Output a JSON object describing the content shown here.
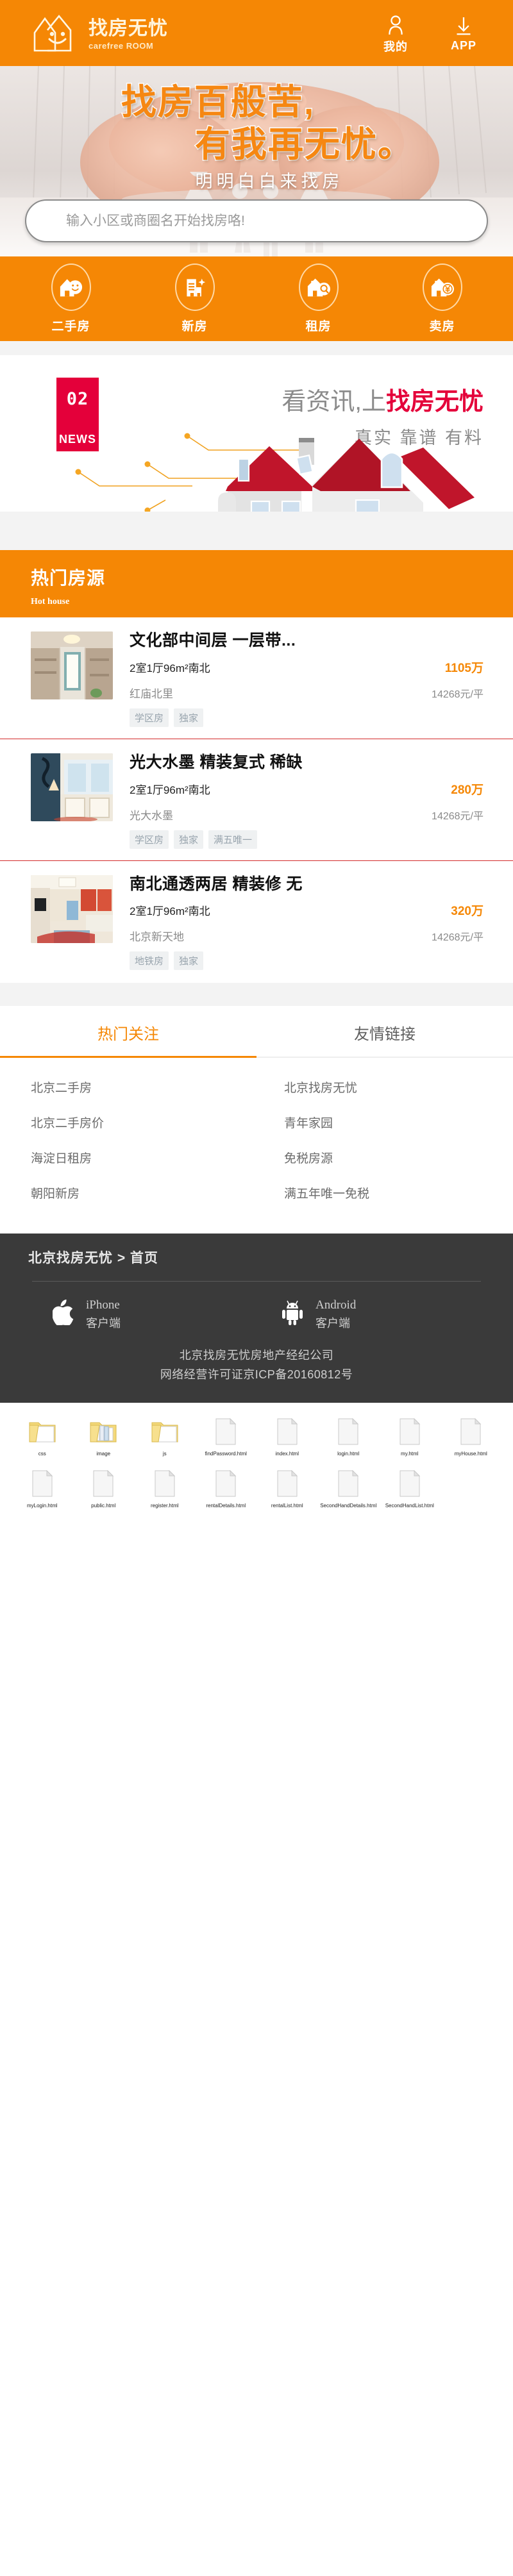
{
  "header": {
    "brand_name": "找房无忧",
    "brand_sub": "carefree ROOM",
    "actions": [
      {
        "label": "我的",
        "icon": "user-icon"
      },
      {
        "label": "APP",
        "icon": "download-icon"
      }
    ]
  },
  "hero": {
    "line1": "找房百般苦,",
    "line2": "有我再无忧。",
    "line3": "明明白白来找房"
  },
  "search": {
    "value": "",
    "placeholder": "输入小区或商圈名开始找房咯!"
  },
  "categories": [
    {
      "label": "二手房",
      "icon": "house-smile-icon"
    },
    {
      "label": "新房",
      "icon": "new-building-icon"
    },
    {
      "label": "租房",
      "icon": "house-search-icon"
    },
    {
      "label": "卖房",
      "icon": "house-yuan-icon"
    }
  ],
  "news": {
    "badge_number": "02",
    "badge_word": "NEWS",
    "title_gray": "看资讯,上",
    "title_red": "找房无忧",
    "subtitle": "真实 靠谱 有料"
  },
  "hot_house": {
    "title_cn": "热门房源",
    "title_en": "Hot house",
    "listings": [
      {
        "title": "文化部中间层 一层带...",
        "spec": "2室1厅96m²南北",
        "price": "1105万",
        "area": "红庙北里",
        "unit_price": "14268元/平",
        "tags": [
          "学区房",
          "独家"
        ]
      },
      {
        "title": "光大水墨 精装复式 稀缺",
        "spec": "2室1厅96m²南北",
        "price": "280万",
        "area": "光大水墨",
        "unit_price": "14268元/平",
        "tags": [
          "学区房",
          "独家",
          "满五唯一"
        ]
      },
      {
        "title": "南北通透两居 精装修 无",
        "spec": "2室1厅96m²南北",
        "price": "320万",
        "area": "北京新天地",
        "unit_price": "14268元/平",
        "tags": [
          "地铁房",
          "独家"
        ]
      }
    ]
  },
  "footer_links": {
    "tabs": [
      {
        "label": "热门关注",
        "active": true
      },
      {
        "label": "友情链接",
        "active": false
      }
    ],
    "left_links": [
      "北京二手房",
      "北京二手房价",
      "海淀日租房",
      "朝阳新房"
    ],
    "right_links": [
      "北京找房无忧",
      "青年家园",
      "免税房源",
      "满五年唯一免税"
    ]
  },
  "dark_footer": {
    "breadcrumb": "北京找房无忧 > 首页",
    "apps": [
      {
        "icon": "apple-icon",
        "en": "iPhone",
        "cn": "客户端"
      },
      {
        "icon": "android-icon",
        "en": "Android",
        "cn": "客户端"
      }
    ],
    "legal_line1": "北京找房无忧房地产经纪公司",
    "legal_line2": "网络经营许可证京ICP备20160812号"
  },
  "files": [
    {
      "name": "css",
      "type": "folder"
    },
    {
      "name": "image",
      "type": "folder-full"
    },
    {
      "name": "js",
      "type": "folder"
    },
    {
      "name": "findPassword.html",
      "type": "file"
    },
    {
      "name": "index.html",
      "type": "file"
    },
    {
      "name": "login.html",
      "type": "file"
    },
    {
      "name": "my.html",
      "type": "file"
    },
    {
      "name": "myHouse.html",
      "type": "file"
    },
    {
      "name": "myLogin.html",
      "type": "file"
    },
    {
      "name": "public.html",
      "type": "file"
    },
    {
      "name": "register.html",
      "type": "file"
    },
    {
      "name": "rentalDetails.html",
      "type": "file"
    },
    {
      "name": "rentalList.html",
      "type": "file"
    },
    {
      "name": "SecondHandDetails.html",
      "type": "file"
    },
    {
      "name": "SecondHandList.html",
      "type": "file"
    }
  ],
  "colors": {
    "brand_orange": "#F58705",
    "news_red": "#E4003A",
    "footer_dark": "#3a3a3a"
  }
}
